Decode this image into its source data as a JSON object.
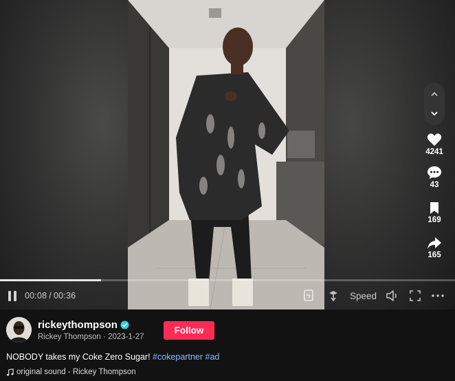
{
  "player": {
    "elapsed": "00:08",
    "separator": "/",
    "duration": "00:36",
    "progress_fraction": 0.222,
    "speed_label": "Speed"
  },
  "navigation": {
    "prev_icon": "chevron-up-icon",
    "next_icon": "chevron-down-icon"
  },
  "actions": {
    "likes": "4241",
    "comments": "43",
    "bookmarks": "169",
    "shares": "165"
  },
  "author": {
    "username": "rickeythompson",
    "display_name": "Rickey Thompson",
    "date": "2023-1-27",
    "dot": "·",
    "verified": true
  },
  "follow_label": "Follow",
  "description": {
    "text": "NOBODY takes my Coke Zero Sugar! ",
    "hashtag1": "#cokepartner",
    "hashtag2": "#ad"
  },
  "sound": {
    "label": "original sound - Rickey Thompson"
  },
  "colors": {
    "accent": "#fe2c55",
    "hashtag": "#8fb8ff",
    "verified": "#20d5ec",
    "background": "#121212"
  }
}
